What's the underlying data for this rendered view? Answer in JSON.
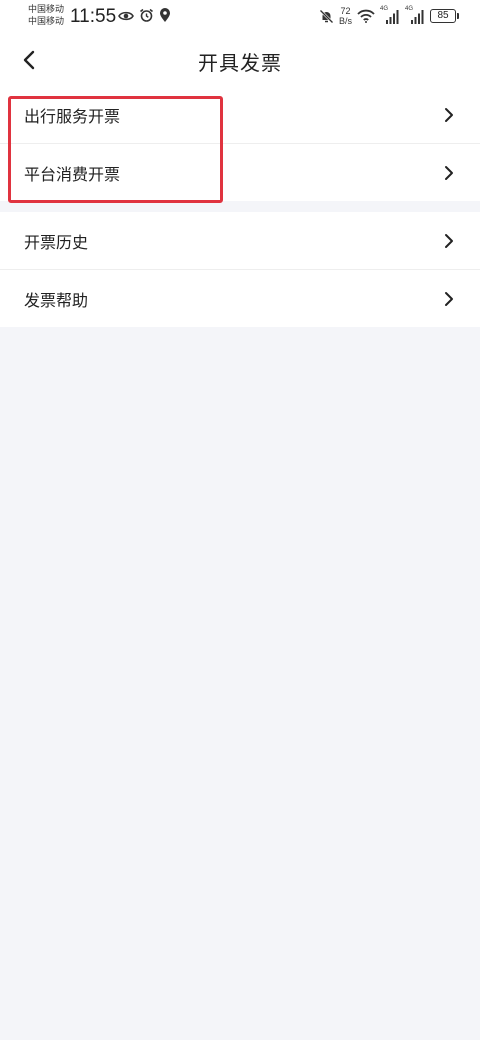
{
  "status_bar": {
    "carrier_1": "中国移动",
    "carrier_2": "中国移动",
    "time": "11:55",
    "net_speed_value": "72",
    "net_speed_unit": "B/s",
    "signal_1_label": "4G",
    "signal_2_label": "4G",
    "battery": "85"
  },
  "nav": {
    "title": "开具发票"
  },
  "groups": [
    {
      "items": [
        {
          "label": "出行服务开票"
        },
        {
          "label": "平台消费开票"
        }
      ]
    },
    {
      "items": [
        {
          "label": "开票历史"
        },
        {
          "label": "发票帮助"
        }
      ]
    }
  ],
  "colors": {
    "page_background": "#f4f5f9",
    "card_background": "#ffffff",
    "highlight": "#e0333f",
    "text": "#222222"
  },
  "icons": {
    "back": "chevron-left-icon",
    "row_arrow": "chevron-right-icon"
  }
}
